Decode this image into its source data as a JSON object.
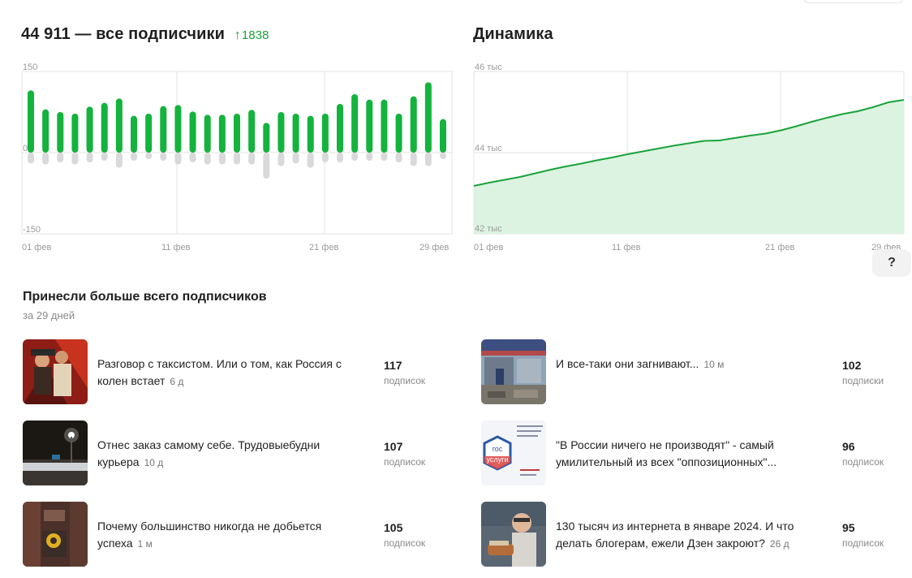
{
  "subscribers": {
    "total": "44 911",
    "title_suffix": "— все подписчики",
    "delta": "1838",
    "arrow_icon": "arrow-up-icon"
  },
  "dynamics": {
    "title": "Динамика"
  },
  "colors": {
    "accent": "#13b33d",
    "accent_fill": "#dcf3e1",
    "negative": "#d9d9d9",
    "delta": "#1aa33b"
  },
  "chart_data": [
    {
      "type": "bar",
      "ylim": [
        -150,
        150
      ],
      "ytick_labels": [
        "150",
        "0",
        "-150"
      ],
      "xtick_labels": [
        "01 фев",
        "11 фев",
        "21 фев",
        "29 фев"
      ],
      "grid": true,
      "series": [
        {
          "values": [
            115,
            80,
            75,
            72,
            85,
            92,
            100,
            68,
            72,
            86,
            88,
            76,
            70,
            70,
            72,
            79,
            55,
            75,
            72,
            68,
            72,
            90,
            108,
            98,
            98,
            72,
            104,
            130,
            62
          ]
        },
        {
          "values": [
            -20,
            -22,
            -18,
            -22,
            -18,
            -15,
            -28,
            -15,
            -12,
            -15,
            -22,
            -18,
            -22,
            -22,
            -22,
            -22,
            -48,
            -25,
            -20,
            -28,
            -18,
            -18,
            -15,
            -15,
            -15,
            -18,
            -25,
            -25,
            -12
          ]
        }
      ]
    },
    {
      "type": "area",
      "ylim": [
        42000,
        46000
      ],
      "ytick_labels": [
        "46 тыс",
        "44 тыс",
        "42 тыс"
      ],
      "xtick_labels": [
        "01 фев",
        "11 фев",
        "21 фев",
        "29 фев"
      ],
      "grid": true,
      "x": [
        1,
        2,
        3,
        4,
        5,
        6,
        7,
        8,
        9,
        10,
        11,
        12,
        13,
        14,
        15,
        16,
        17,
        18,
        19,
        20,
        21,
        22,
        23,
        24,
        25,
        26,
        27,
        28,
        29
      ],
      "values": [
        43180,
        43260,
        43330,
        43400,
        43490,
        43580,
        43660,
        43730,
        43810,
        43880,
        43960,
        44030,
        44100,
        44170,
        44230,
        44290,
        44300,
        44360,
        44420,
        44470,
        44550,
        44650,
        44760,
        44860,
        44950,
        45020,
        45120,
        45240,
        45300
      ]
    }
  ],
  "help": {
    "label": "?"
  },
  "top_posts": {
    "title": "Принесли больше всего подписчиков",
    "subtitle": "за 29 дней",
    "left": [
      {
        "title": "Разговор с таксистом. Или о том, как Россия с колен встает",
        "age": "6 д",
        "count": "117",
        "unit": "подписок"
      },
      {
        "title": "Отнес заказ самому себе. Трудовыебудни курьера",
        "age": "10 д",
        "count": "107",
        "unit": "подписок"
      },
      {
        "title": "Почему большинство никогда не добьется успеха",
        "age": "1 м",
        "count": "105",
        "unit": "подписок"
      }
    ],
    "right": [
      {
        "title": "И все-таки они загнивают...",
        "age": "10 м",
        "count": "102",
        "unit": "подписки"
      },
      {
        "title": "\"В России ничего не производят\" - самый умилительный из всех \"оппозиционных\"...",
        "age": "",
        "count": "96",
        "unit": "подписок"
      },
      {
        "title": "130 тысяч из интернета в январе 2024. И что делать блогерам, ежели Дзен закроют?",
        "age": "26 д",
        "count": "95",
        "unit": "подписок"
      }
    ],
    "thumb_logo_text": [
      "гос",
      "услуги"
    ]
  }
}
